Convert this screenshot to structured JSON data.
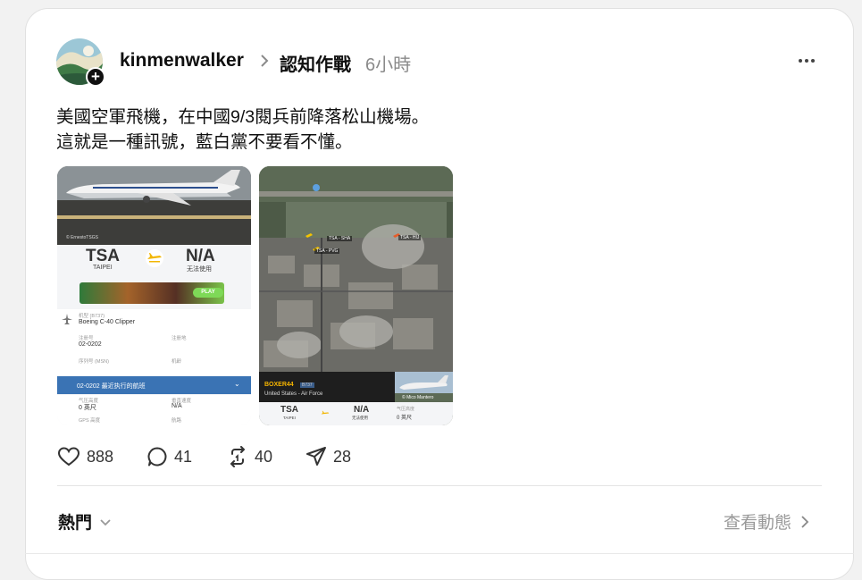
{
  "post": {
    "username": "kinmenwalker",
    "topic": "認知作戰",
    "time": "6小時",
    "text_lines": [
      "美國空軍飛機，在中國9/3閱兵前降落松山機場。",
      "這就是一種訊號，藍白黨不要看不懂。"
    ]
  },
  "screenshot1": {
    "photo_credit": "© ErnestoTSGS",
    "origin_code": "TSA",
    "origin_city": "TAIPEI",
    "dest_code": "N/A",
    "dest_note": "无法使用",
    "ad_play": "PLAY",
    "aircraft_label": "机型 (B737)",
    "aircraft_name": "Boeing C-40 Clipper",
    "reg_label": "注册号",
    "reg_value": "02-0202",
    "country_label": "注册地",
    "msn_label": "序列号 (MSN)",
    "airline_label": "机龄",
    "recent_flights": "02-0202 最近执行的航班",
    "alt_label": "气压高度",
    "alt_value": "0 英尺",
    "vs_label": "垂直速度",
    "vs_value": "N/A",
    "gps_label": "GPS 高度",
    "track_label": "航路"
  },
  "screenshot2": {
    "map_label_1": "TSA - SHA",
    "map_label_2": "TSA - PVG",
    "map_label_3": "TSA - HIJ",
    "callsign": "BOXER44",
    "type_badge": "B737",
    "owner": "United States - Air Force",
    "photo_credit": "© Mico Mantero",
    "origin_code": "TSA",
    "origin_city": "TAIPEI",
    "dest_code": "N/A",
    "dest_note": "无法使用",
    "alt_label": "气压高度",
    "alt_value": "0 英尺"
  },
  "actions": {
    "likes": "888",
    "comments": "41",
    "reposts": "40",
    "shares": "28"
  },
  "footer": {
    "hot_label": "熱門",
    "view_activity": "查看動態"
  }
}
